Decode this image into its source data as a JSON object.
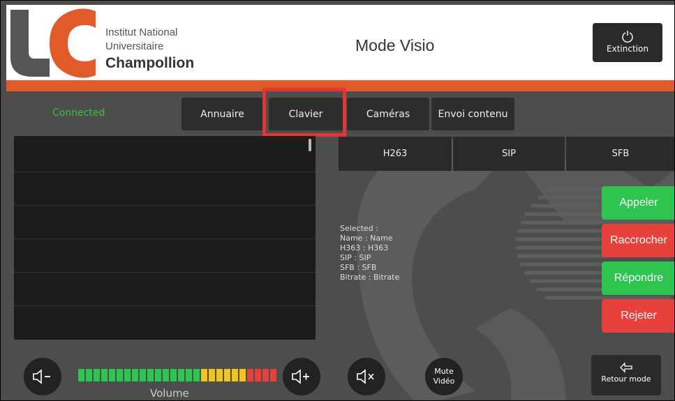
{
  "header": {
    "institution_line1": "Institut National",
    "institution_line2": "Universitaire",
    "institution_line3": "Champollion",
    "title": "Mode Visio",
    "power_button_label": "Extinction",
    "logo_letters": "UC"
  },
  "status": {
    "connection": "Connected"
  },
  "tabs": [
    {
      "label": "Annuaire"
    },
    {
      "label": "Clavier",
      "highlighted": true
    },
    {
      "label": "Caméras"
    },
    {
      "label": "Envoi contenu"
    }
  ],
  "protocols": [
    {
      "label": "H263"
    },
    {
      "label": "SIP"
    },
    {
      "label": "SFB"
    }
  ],
  "selection_info": {
    "line1": "Selected :",
    "line2": "Name : Name",
    "line3": "H363 : H363",
    "line4": "SIP : SIP",
    "line5": "SFB : SFB",
    "line6": "Bitrate : Bitrate"
  },
  "actions": {
    "call": "Appeler",
    "hangup": "Raccrocher",
    "answer": "Répondre",
    "reject": "Rejeter"
  },
  "controls": {
    "mute_video": "Mute Vidéo",
    "volume_label": "Volume",
    "return_label": "Retour mode"
  },
  "vumeter": {
    "segments": 26,
    "green_segments": 16,
    "yellow_segments": 6,
    "red_segments": 4
  },
  "colors": {
    "accent_orange": "#e05a2a",
    "green": "#2dc44f",
    "red": "#e8403a",
    "highlight": "#e63434"
  },
  "icons": {
    "power": "power-icon",
    "volume_down": "volume-down-icon",
    "volume_up": "volume-up-icon",
    "volume_mute": "volume-mute-icon",
    "return": "return-arrow-icon"
  }
}
